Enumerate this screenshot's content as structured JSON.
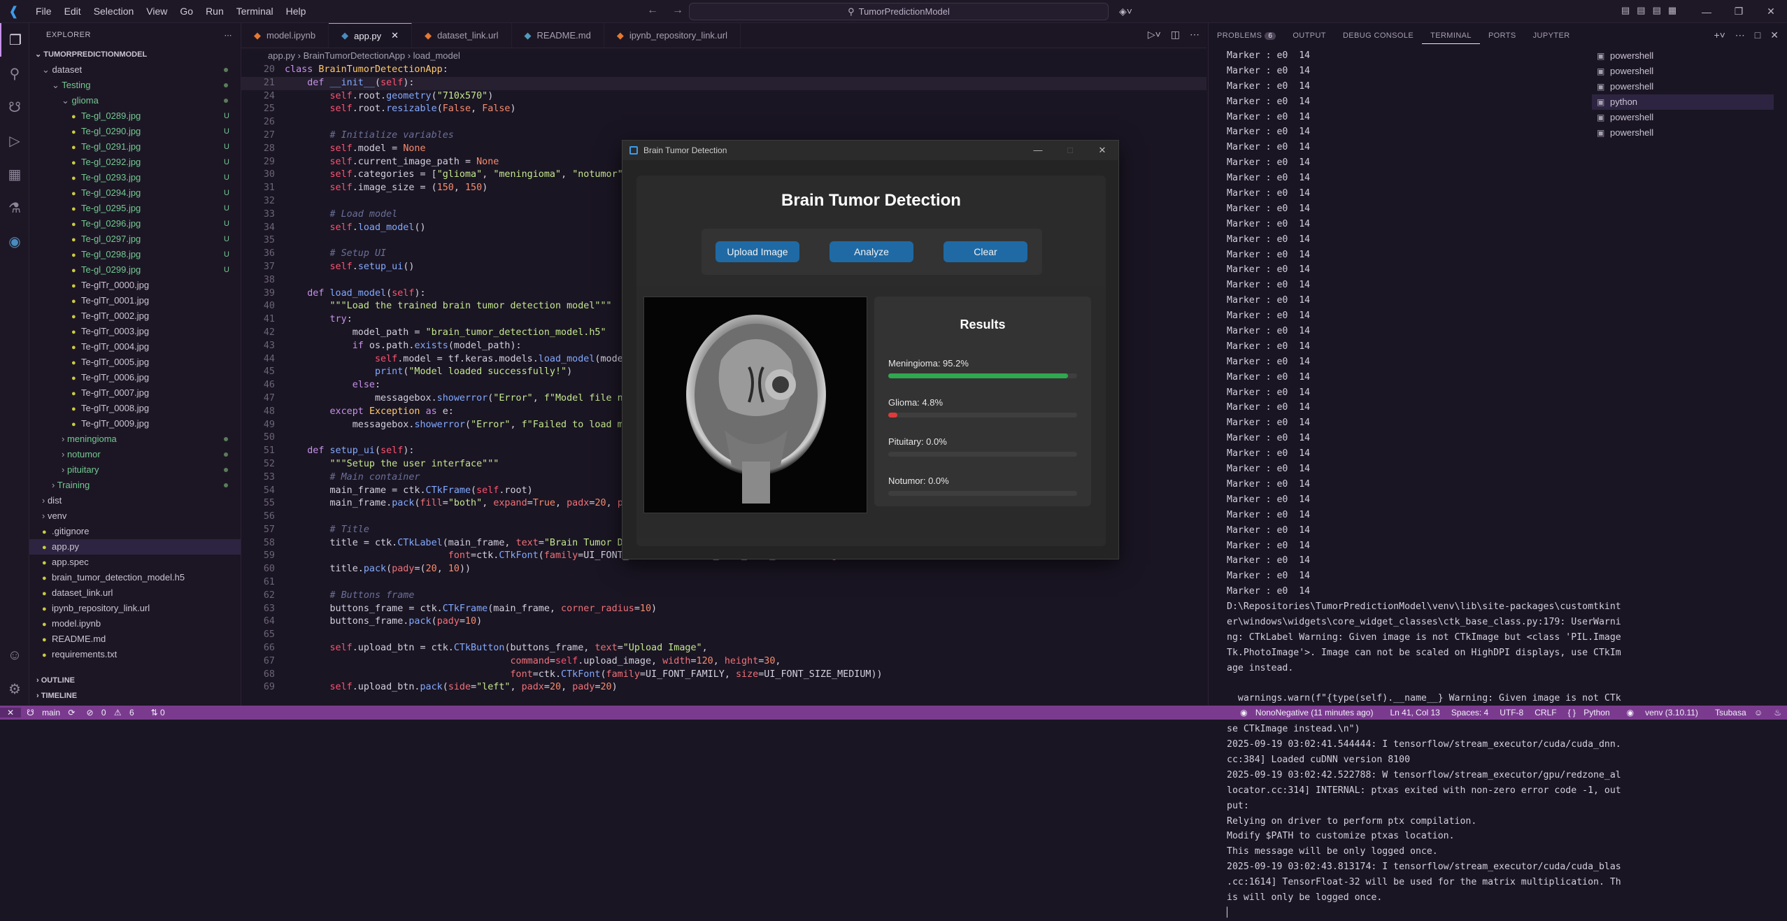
{
  "titlebar": {
    "menus": [
      "File",
      "Edit",
      "Selection",
      "View",
      "Go",
      "Run",
      "Terminal",
      "Help"
    ],
    "search": "TumorPredictionModel"
  },
  "explorer": {
    "header": "EXPLORER",
    "project": "TUMORPREDICTIONMODEL",
    "rows": [
      {
        "label": "dataset",
        "indent": 1,
        "kind": "folder-open",
        "dot": true
      },
      {
        "label": "Testing",
        "indent": 2,
        "kind": "folder-open",
        "dot": true,
        "green": true
      },
      {
        "label": "glioma",
        "indent": 3,
        "kind": "folder-open",
        "dot": true,
        "green": true
      },
      {
        "label": "Te-gl_0289.jpg",
        "indent": 4,
        "badge": "U",
        "green": true
      },
      {
        "label": "Te-gl_0290.jpg",
        "indent": 4,
        "badge": "U",
        "green": true
      },
      {
        "label": "Te-gl_0291.jpg",
        "indent": 4,
        "badge": "U",
        "green": true
      },
      {
        "label": "Te-gl_0292.jpg",
        "indent": 4,
        "badge": "U",
        "green": true
      },
      {
        "label": "Te-gl_0293.jpg",
        "indent": 4,
        "badge": "U",
        "green": true
      },
      {
        "label": "Te-gl_0294.jpg",
        "indent": 4,
        "badge": "U",
        "green": true
      },
      {
        "label": "Te-gl_0295.jpg",
        "indent": 4,
        "badge": "U",
        "green": true
      },
      {
        "label": "Te-gl_0296.jpg",
        "indent": 4,
        "badge": "U",
        "green": true
      },
      {
        "label": "Te-gl_0297.jpg",
        "indent": 4,
        "badge": "U",
        "green": true
      },
      {
        "label": "Te-gl_0298.jpg",
        "indent": 4,
        "badge": "U",
        "green": true
      },
      {
        "label": "Te-gl_0299.jpg",
        "indent": 4,
        "badge": "U",
        "green": true
      },
      {
        "label": "Te-glTr_0000.jpg",
        "indent": 4
      },
      {
        "label": "Te-glTr_0001.jpg",
        "indent": 4
      },
      {
        "label": "Te-glTr_0002.jpg",
        "indent": 4
      },
      {
        "label": "Te-glTr_0003.jpg",
        "indent": 4
      },
      {
        "label": "Te-glTr_0004.jpg",
        "indent": 4
      },
      {
        "label": "Te-glTr_0005.jpg",
        "indent": 4
      },
      {
        "label": "Te-glTr_0006.jpg",
        "indent": 4
      },
      {
        "label": "Te-glTr_0007.jpg",
        "indent": 4
      },
      {
        "label": "Te-glTr_0008.jpg",
        "indent": 4
      },
      {
        "label": "Te-glTr_0009.jpg",
        "indent": 4
      },
      {
        "label": "meningioma",
        "indent": 3,
        "kind": "folder",
        "dot": true,
        "green": true
      },
      {
        "label": "notumor",
        "indent": 3,
        "kind": "folder",
        "dot": true,
        "green": true
      },
      {
        "label": "pituitary",
        "indent": 3,
        "kind": "folder",
        "dot": true,
        "green": true
      },
      {
        "label": "Training",
        "indent": 2,
        "kind": "folder",
        "dot": true,
        "green": true
      },
      {
        "label": "dist",
        "indent": 1,
        "kind": "folder"
      },
      {
        "label": "venv",
        "indent": 1,
        "kind": "folder"
      },
      {
        "label": ".gitignore",
        "indent": 1
      },
      {
        "label": "app.py",
        "indent": 1,
        "selected": true
      },
      {
        "label": "app.spec",
        "indent": 1
      },
      {
        "label": "brain_tumor_detection_model.h5",
        "indent": 1
      },
      {
        "label": "dataset_link.url",
        "indent": 1
      },
      {
        "label": "ipynb_repository_link.url",
        "indent": 1
      },
      {
        "label": "model.ipynb",
        "indent": 1
      },
      {
        "label": "README.md",
        "indent": 1
      },
      {
        "label": "requirements.txt",
        "indent": 1
      }
    ],
    "outline": "OUTLINE",
    "timeline": "TIMELINE"
  },
  "tabs": [
    {
      "label": "model.ipynb",
      "active": false
    },
    {
      "label": "app.py",
      "active": true
    },
    {
      "label": "dataset_link.url",
      "active": false
    },
    {
      "label": "README.md",
      "active": false
    },
    {
      "label": "ipynb_repository_link.url",
      "active": false
    }
  ],
  "breadcrumb": [
    "app.py",
    "BrainTumorDetectionApp",
    "load_model"
  ],
  "code": [
    {
      "n": "20",
      "h": "<span class='kw'>class</span> <span class='cls'>BrainTumorDetectionApp</span>:"
    },
    {
      "n": "21",
      "h": "    <span class='kw'>def</span> <span class='fn'>__init__</span>(<span class='sf'>self</span>):"
    },
    {
      "n": "24",
      "h": "        <span class='sf'>self</span>.root.<span class='fn'>geometry</span>(<span class='st'>\"710x570\"</span>)"
    },
    {
      "n": "25",
      "h": "        <span class='sf'>self</span>.root.<span class='fn'>resizable</span>(<span class='nu'>False</span>, <span class='nu'>False</span>)"
    },
    {
      "n": "26",
      "h": ""
    },
    {
      "n": "27",
      "h": "        <span class='cm'># Initialize variables</span>"
    },
    {
      "n": "28",
      "h": "        <span class='sf'>self</span>.model = <span class='nu'>None</span>"
    },
    {
      "n": "29",
      "h": "        <span class='sf'>self</span>.current_image_path = <span class='nu'>None</span>"
    },
    {
      "n": "30",
      "h": "        <span class='sf'>self</span>.categories = [<span class='st'>\"glioma\"</span>, <span class='st'>\"meningioma\"</span>, <span class='st'>\"notumor\"</span>, <span class='st'>\"pituitary\"</span>]"
    },
    {
      "n": "31",
      "h": "        <span class='sf'>self</span>.image_size = (<span class='nu'>150</span>, <span class='nu'>150</span>)"
    },
    {
      "n": "32",
      "h": ""
    },
    {
      "n": "33",
      "h": "        <span class='cm'># Load model</span>"
    },
    {
      "n": "34",
      "h": "        <span class='sf'>self</span>.<span class='fn'>load_model</span>()"
    },
    {
      "n": "35",
      "h": ""
    },
    {
      "n": "36",
      "h": "        <span class='cm'># Setup UI</span>"
    },
    {
      "n": "37",
      "h": "        <span class='sf'>self</span>.<span class='fn'>setup_ui</span>()"
    },
    {
      "n": "38",
      "h": ""
    },
    {
      "n": "39",
      "h": "    <span class='kw'>def</span> <span class='fn'>load_model</span>(<span class='sf'>self</span>):"
    },
    {
      "n": "40",
      "h": "        <span class='st'>\"\"\"Load the trained brain tumor detection model\"\"\"</span>"
    },
    {
      "n": "41",
      "h": "        <span class='kw'>try</span>:"
    },
    {
      "n": "42",
      "h": "            model_path = <span class='st'>\"brain_tumor_detection_model.h5\"</span>"
    },
    {
      "n": "43",
      "h": "            <span class='kw'>if</span> os.path.<span class='fn'>exists</span>(model_path):"
    },
    {
      "n": "44",
      "h": "                <span class='sf'>self</span>.model = tf.keras.models.<span class='fn'>load_model</span>(model_path)"
    },
    {
      "n": "45",
      "h": "                <span class='fn'>print</span>(<span class='st'>\"Model loaded successfully!\"</span>)"
    },
    {
      "n": "46",
      "h": "            <span class='kw'>else</span>:"
    },
    {
      "n": "47",
      "h": "                messagebox.<span class='fn'>showerror</span>(<span class='st'>\"Error\"</span>, <span class='st'>f\"Model file not found\"</span>)"
    },
    {
      "n": "48",
      "h": "        <span class='kw'>except</span> <span class='cls'>Exception</span> <span class='kw'>as</span> e:"
    },
    {
      "n": "49",
      "h": "            messagebox.<span class='fn'>showerror</span>(<span class='st'>\"Error\"</span>, <span class='st'>f\"Failed to load model\"</span>)"
    },
    {
      "n": "50",
      "h": ""
    },
    {
      "n": "51",
      "h": "    <span class='kw'>def</span> <span class='fn'>setup_ui</span>(<span class='sf'>self</span>):"
    },
    {
      "n": "52",
      "h": "        <span class='st'>\"\"\"Setup the user interface\"\"\"</span>"
    },
    {
      "n": "53",
      "h": "        <span class='cm'># Main container</span>"
    },
    {
      "n": "54",
      "h": "        main_frame = ctk.<span class='fn'>CTkFrame</span>(<span class='sf'>self</span>.root)"
    },
    {
      "n": "55",
      "h": "        main_frame.<span class='fn'>pack</span>(<span class='ar'>fill</span>=<span class='st'>\"both\"</span>, <span class='ar'>expand</span>=<span class='nu'>True</span>, <span class='ar'>padx</span>=<span class='nu'>20</span>, <span class='ar'>pady</span>=<span class='nu'>20</span>)"
    },
    {
      "n": "56",
      "h": ""
    },
    {
      "n": "57",
      "h": "        <span class='cm'># Title</span>"
    },
    {
      "n": "58",
      "h": "        title = ctk.<span class='fn'>CTkLabel</span>(main_frame, <span class='ar'>text</span>=<span class='st'>\"Brain Tumor Detection\"</span>,"
    },
    {
      "n": "59",
      "h": "                             <span class='ar'>font</span>=ctk.<span class='fn'>CTkFont</span>(<span class='ar'>family</span>=UI_FONT_FAMILY, <span class='ar'>size</span>=UI_FONT_SIZE_TITLE, <span class='ar'>weight</span>=<span class='st'>\"bold\"</span>))"
    },
    {
      "n": "60",
      "h": "        title.<span class='fn'>pack</span>(<span class='ar'>pady</span>=(<span class='nu'>20</span>, <span class='nu'>10</span>))"
    },
    {
      "n": "61",
      "h": ""
    },
    {
      "n": "62",
      "h": "        <span class='cm'># Buttons frame</span>"
    },
    {
      "n": "63",
      "h": "        buttons_frame = ctk.<span class='fn'>CTkFrame</span>(main_frame, <span class='ar'>corner_radius</span>=<span class='nu'>10</span>)"
    },
    {
      "n": "64",
      "h": "        buttons_frame.<span class='fn'>pack</span>(<span class='ar'>pady</span>=<span class='nu'>10</span>)"
    },
    {
      "n": "65",
      "h": ""
    },
    {
      "n": "66",
      "h": "        <span class='sf'>self</span>.upload_btn = ctk.<span class='fn'>CTkButton</span>(buttons_frame, <span class='ar'>text</span>=<span class='st'>\"Upload Image\"</span>,"
    },
    {
      "n": "67",
      "h": "                                        <span class='ar'>command</span>=<span class='sf'>self</span>.upload_image, <span class='ar'>width</span>=<span class='nu'>120</span>, <span class='ar'>height</span>=<span class='nu'>30</span>,"
    },
    {
      "n": "68",
      "h": "                                        <span class='ar'>font</span>=ctk.<span class='fn'>CTkFont</span>(<span class='ar'>family</span>=UI_FONT_FAMILY, <span class='ar'>size</span>=UI_FONT_SIZE_MEDIUM))"
    },
    {
      "n": "69",
      "h": "        <span class='sf'>self</span>.upload_btn.<span class='fn'>pack</span>(<span class='ar'>side</span>=<span class='st'>\"left\"</span>, <span class='ar'>padx</span>=<span class='nu'>20</span>, <span class='ar'>pady</span>=<span class='nu'>20</span>)"
    }
  ],
  "panel": {
    "tabs": [
      "PROBLEMS",
      "OUTPUT",
      "DEBUG CONSOLE",
      "TERMINAL",
      "PORTS",
      "JUPYTER"
    ],
    "problems_count": "6",
    "terminal_lines": [
      "Marker : e0  14",
      "Marker : e0  14",
      "Marker : e0  14",
      "Marker : e0  14",
      "Marker : e0  14",
      "Marker : e0  14",
      "Marker : e0  14",
      "Marker : e0  14",
      "Marker : e0  14",
      "Marker : e0  14",
      "Marker : e0  14",
      "Marker : e0  14",
      "Marker : e0  14",
      "Marker : e0  14",
      "Marker : e0  14",
      "Marker : e0  14",
      "Marker : e0  14",
      "Marker : e0  14",
      "Marker : e0  14",
      "Marker : e0  14",
      "Marker : e0  14",
      "Marker : e0  14",
      "Marker : e0  14",
      "Marker : e0  14",
      "Marker : e0  14",
      "Marker : e0  14",
      "Marker : e0  14",
      "Marker : e0  14",
      "Marker : e0  14",
      "Marker : e0  14",
      "Marker : e0  14",
      "Marker : e0  14",
      "Marker : e0  14",
      "Marker : e0  14",
      "Marker : e0  14",
      "Marker : e0  14",
      "D:\\Repositories\\TumorPredictionModel\\venv\\lib\\site-packages\\customtkint",
      "er\\windows\\widgets\\core_widget_classes\\ctk_base_class.py:179: UserWarni",
      "ng: CTkLabel Warning: Given image is not CTkImage but <class 'PIL.Image",
      "Tk.PhotoImage'>. Image can not be scaled on HighDPI displays, use CTkIm",
      "age instead.",
      "",
      "  warnings.warn(f\"{type(self).__name__} Warning: Given image is not CTk",
      "Image but {type(image)}. Image can not be scaled on HighDPI displays, u",
      "se CTkImage instead.\\n\")",
      "2025-09-19 03:02:41.544444: I tensorflow/stream_executor/cuda/cuda_dnn.",
      "cc:384] Loaded cuDNN version 8100",
      "2025-09-19 03:02:42.522788: W tensorflow/stream_executor/gpu/redzone_al",
      "locator.cc:314] INTERNAL: ptxas exited with non-zero error code -1, out",
      "put:",
      "Relying on driver to perform ptx compilation.",
      "Modify $PATH to customize ptxas location.",
      "This message will be only logged once.",
      "2025-09-19 03:02:43.813174: I tensorflow/stream_executor/cuda/cuda_blas",
      ".cc:1614] TensorFloat-32 will be used for the matrix multiplication. Th",
      "is will only be logged once.",
      "▏"
    ],
    "terminals": [
      {
        "label": "powershell",
        "selected": false
      },
      {
        "label": "powershell",
        "selected": false
      },
      {
        "label": "powershell",
        "selected": false
      },
      {
        "label": "python",
        "selected": true
      },
      {
        "label": "powershell",
        "selected": false
      },
      {
        "label": "powershell",
        "selected": false
      }
    ]
  },
  "dialog": {
    "window_title": "Brain Tumor Detection",
    "heading": "Brain Tumor Detection",
    "buttons": {
      "upload": "Upload Image",
      "analyze": "Analyze",
      "clear": "Clear"
    },
    "results_title": "Results",
    "results": [
      {
        "label": "Meningioma: 95.2%",
        "value": 0.952,
        "color": "#2fa84f"
      },
      {
        "label": "Glioma: 4.8%",
        "value": 0.048,
        "color": "#e03b3b"
      },
      {
        "label": "Pituitary: 0.0%",
        "value": 0.0,
        "color": "#2fa84f"
      },
      {
        "label": "Notumor: 0.0%",
        "value": 0.0,
        "color": "#2fa84f"
      }
    ]
  },
  "statusbar": {
    "branch": "main",
    "errors": "0",
    "warnings": "6",
    "blame": "NonoNegative (11 minutes ago)",
    "cursor": "Ln 41, Col 13",
    "spaces": "Spaces: 4",
    "encoding": "UTF-8",
    "eol": "CRLF",
    "language": "Python",
    "interpreter": "venv (3.10.11)",
    "user": "Tsubasa"
  }
}
